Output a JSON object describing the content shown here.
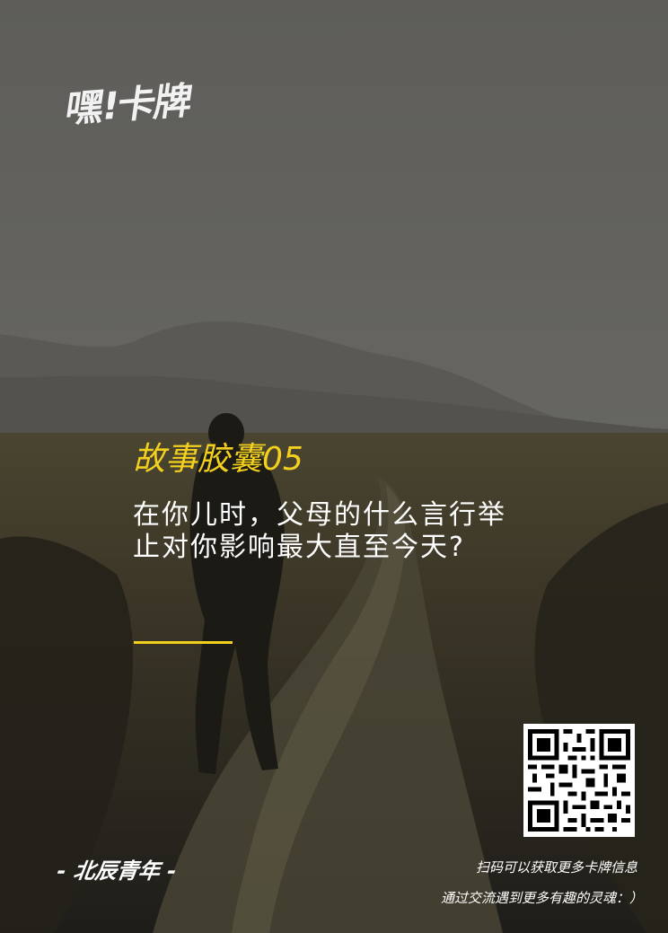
{
  "logo": {
    "text": "嘿!卡牌"
  },
  "card": {
    "title": "故事胶囊05",
    "question": "在你儿时，父母的什么言行举止对你影响最大直至今天?"
  },
  "footer": {
    "brand": "- 北辰青年 -",
    "scan_line1": "扫码可以获取更多卡牌信息",
    "scan_line2": "通过交流遇到更多有趣的灵魂：）"
  },
  "colors": {
    "accent": "#f3d01e",
    "sky": "#6e6d69",
    "ground": "#3a3626"
  },
  "icons": {
    "qr": "qr-code-icon",
    "runner": "runner-silhouette"
  }
}
